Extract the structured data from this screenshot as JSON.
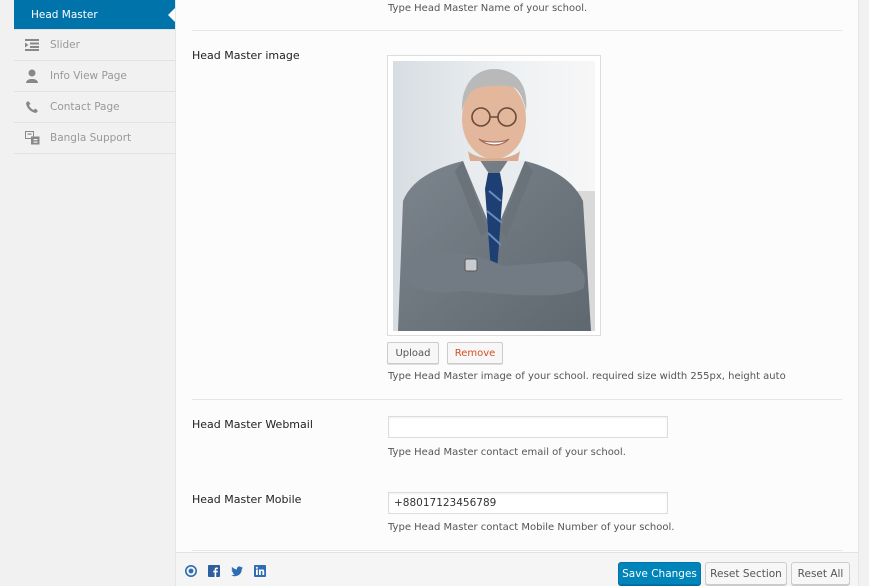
{
  "sidebar": {
    "items": [
      {
        "label": "Head Master",
        "icon": "active-arrow",
        "active": true
      },
      {
        "label": "Slider",
        "icon": "list-indent-icon"
      },
      {
        "label": "Info View Page",
        "icon": "user-icon"
      },
      {
        "label": "Contact Page",
        "icon": "phone-icon"
      },
      {
        "label": "Bangla Support",
        "icon": "translate-icon"
      }
    ]
  },
  "fields": {
    "name_desc": "Type Head Master Name of your school.",
    "image": {
      "label": "Head Master image",
      "upload_label": "Upload",
      "remove_label": "Remove",
      "desc": "Type Head Master image of your school. required size width 255px, height auto"
    },
    "webmail": {
      "label": "Head Master Webmail",
      "value": "",
      "desc": "Type Head Master contact email of your school."
    },
    "mobile": {
      "label": "Head Master Mobile",
      "value": "+88017123456789",
      "desc": "Type Head Master contact Mobile Number of your school."
    }
  },
  "footer": {
    "social_icons": [
      "circle-logo-icon",
      "facebook-icon",
      "twitter-icon",
      "linkedin-icon"
    ],
    "save_label": "Save Changes",
    "reset_section_label": "Reset Section",
    "reset_all_label": "Reset All"
  },
  "colors": {
    "accent": "#0073aa",
    "primary_button": "#0085ba",
    "remove": "#d54e21"
  }
}
